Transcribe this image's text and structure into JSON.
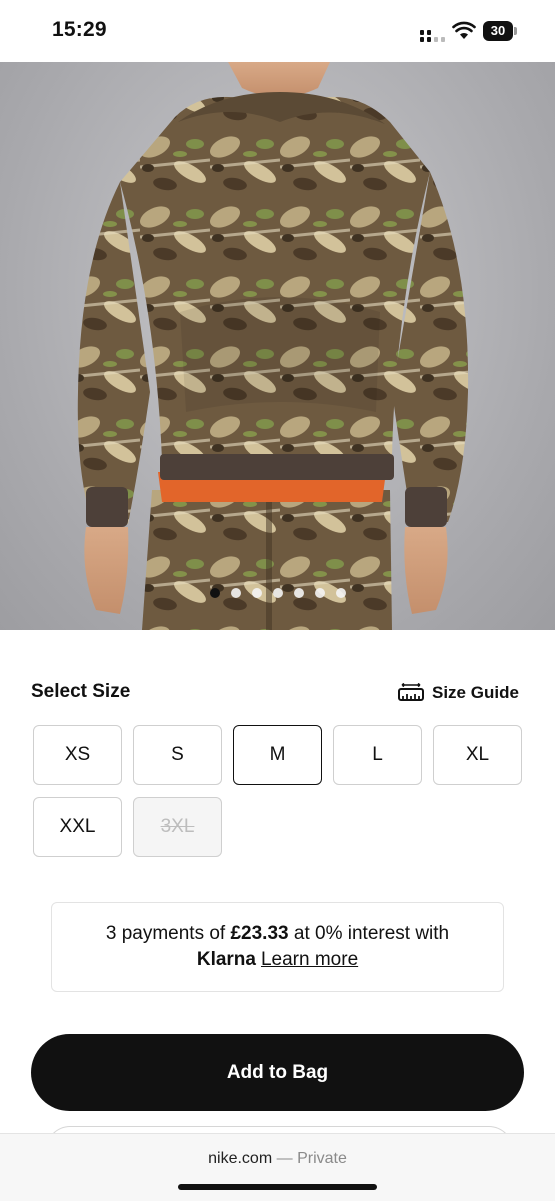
{
  "status_bar": {
    "time": "15:29",
    "battery": "30",
    "icons": [
      "signal-icon",
      "wifi-icon",
      "battery-icon"
    ]
  },
  "product": {
    "image_alt": "camouflage hoodie",
    "carousel": {
      "count": 7,
      "active_index": 0
    }
  },
  "size": {
    "heading": "Select Size",
    "guide_label": "Size Guide",
    "guide_icon": "ruler-icon",
    "options": [
      {
        "label": "XS",
        "state": "available"
      },
      {
        "label": "S",
        "state": "available"
      },
      {
        "label": "M",
        "state": "selected"
      },
      {
        "label": "L",
        "state": "available"
      },
      {
        "label": "XL",
        "state": "available"
      },
      {
        "label": "XXL",
        "state": "available"
      },
      {
        "label": "3XL",
        "state": "unavailable"
      }
    ]
  },
  "klarna": {
    "prefix": "3 payments of",
    "amount": "£23.33",
    "suffix": "at 0% interest with",
    "brand": "Klarna",
    "link": "Learn more"
  },
  "actions": {
    "add_to_bag": "Add to Bag"
  },
  "browser": {
    "domain": "nike.com",
    "separator": "—",
    "mode": "Private"
  },
  "colors": {
    "primary": "#111111",
    "border": "#cfcfcf",
    "disabled_bg": "#f5f5f5",
    "background": "#ffffff"
  }
}
